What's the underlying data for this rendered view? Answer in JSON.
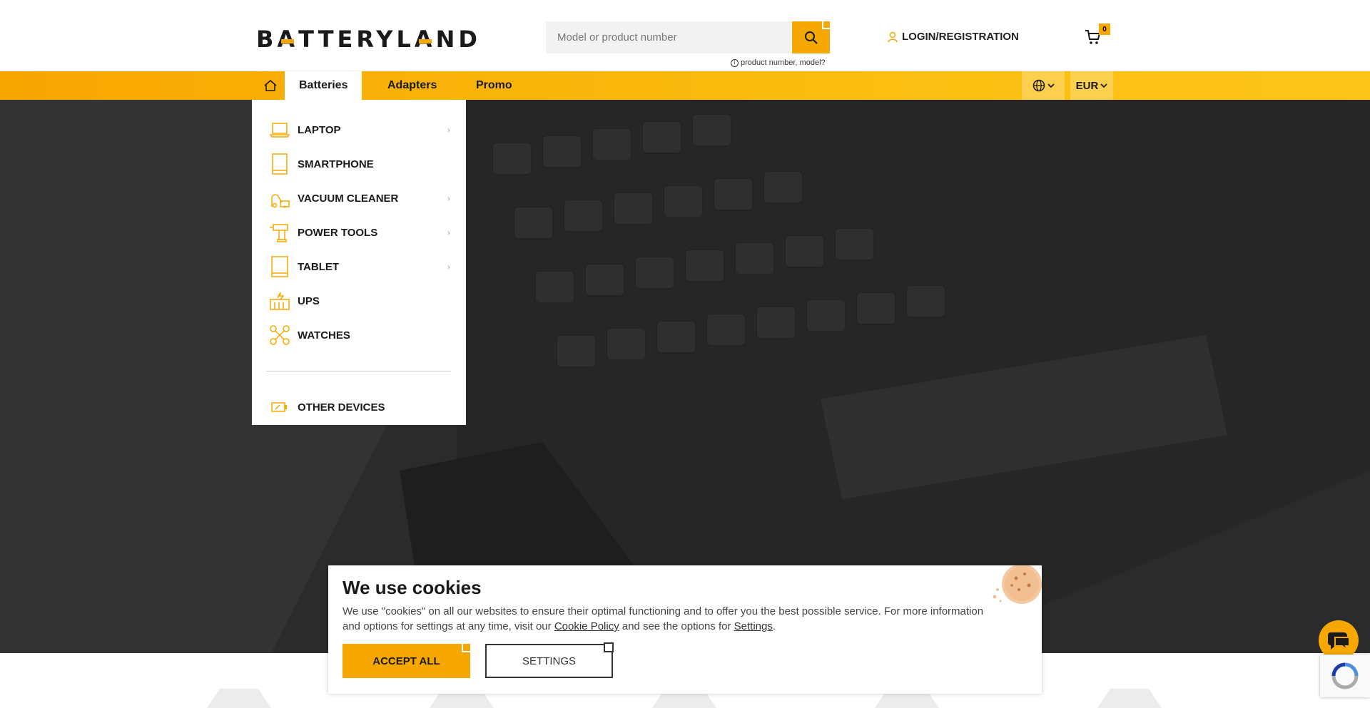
{
  "header": {
    "logo_text": "BATTERYLAND",
    "search": {
      "placeholder": "Model or product number",
      "hint": "product number, model?"
    },
    "login_label": "LOGIN/REGISTRATION",
    "cart_count": "0"
  },
  "nav": {
    "items": [
      {
        "label": "Batteries",
        "active": true
      },
      {
        "label": "Adapters",
        "active": false
      },
      {
        "label": "Promo",
        "active": false
      }
    ],
    "currency": "EUR"
  },
  "dropdown": {
    "items": [
      {
        "label": "LAPTOP",
        "icon": "laptop-icon",
        "has_submenu": true
      },
      {
        "label": "SMARTPHONE",
        "icon": "smartphone-icon",
        "has_submenu": false
      },
      {
        "label": "VACUUM CLEANER",
        "icon": "vacuum-cleaner-icon",
        "has_submenu": true
      },
      {
        "label": "POWER TOOLS",
        "icon": "power-drill-icon",
        "has_submenu": true
      },
      {
        "label": "TABLET",
        "icon": "tablet-icon",
        "has_submenu": true
      },
      {
        "label": "UPS",
        "icon": "ups-icon",
        "has_submenu": false
      },
      {
        "label": "WATCHES",
        "icon": "drone-icon",
        "has_submenu": false
      }
    ],
    "other": {
      "label": "OTHER DEVICES",
      "icon": "battery-icon"
    }
  },
  "cookie": {
    "title": "We use cookies",
    "text_before": "We use \"cookies\" on all our websites to ensure their optimal functioning and to offer you the best possible service. For more information and options for settings at any time, visit our ",
    "policy_link": "Cookie Policy",
    "text_middle": " and see the options for ",
    "settings_link": "Settings",
    "text_after": ".",
    "accept_label": "ACCEPT ALL",
    "settings_label": "SETTINGS"
  },
  "colors": {
    "accent": "#f6a800",
    "dark": "#1a1a1a",
    "hero": "#2c2c2c"
  }
}
